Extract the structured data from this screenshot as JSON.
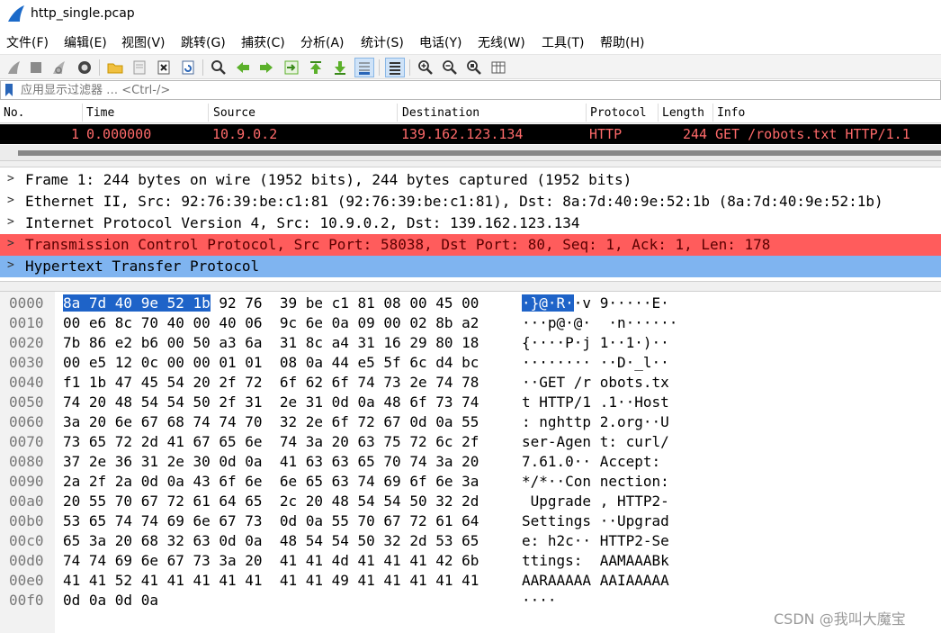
{
  "window": {
    "title": "http_single.pcap"
  },
  "menu": [
    {
      "label": "文件(F)"
    },
    {
      "label": "编辑(E)"
    },
    {
      "label": "视图(V)"
    },
    {
      "label": "跳转(G)"
    },
    {
      "label": "捕获(C)"
    },
    {
      "label": "分析(A)"
    },
    {
      "label": "统计(S)"
    },
    {
      "label": "电话(Y)"
    },
    {
      "label": "无线(W)"
    },
    {
      "label": "工具(T)"
    },
    {
      "label": "帮助(H)"
    }
  ],
  "toolbar_icons": [
    "start-capture",
    "stop-capture",
    "restart-capture",
    "capture-options",
    "open-file",
    "save-file",
    "close-file",
    "reload-file",
    "find-packet",
    "go-back",
    "go-forward",
    "go-to-packet",
    "go-first",
    "go-last",
    "autoscroll",
    "colorize",
    "zoom-in",
    "zoom-out",
    "zoom-normal",
    "resize-columns"
  ],
  "filter": {
    "placeholder": "应用显示过滤器 … <Ctrl-/>"
  },
  "packet_list": {
    "columns": [
      "No.",
      "Time",
      "Source",
      "Destination",
      "Protocol",
      "Length",
      "Info"
    ],
    "rows": [
      {
        "no": "1",
        "time": "0.000000",
        "source": "10.9.0.2",
        "destination": "139.162.123.134",
        "protocol": "HTTP",
        "length": "244",
        "info": "GET /robots.txt HTTP/1.1"
      }
    ]
  },
  "details": [
    "Frame 1: 244 bytes on wire (1952 bits), 244 bytes captured (1952 bits)",
    "Ethernet II, Src: 92:76:39:be:c1:81 (92:76:39:be:c1:81), Dst: 8a:7d:40:9e:52:1b (8a:7d:40:9e:52:1b)",
    "Internet Protocol Version 4, Src: 10.9.0.2, Dst: 139.162.123.134",
    "Transmission Control Protocol, Src Port: 58038, Dst Port: 80, Seq: 1, Ack: 1, Len: 178",
    "Hypertext Transfer Protocol"
  ],
  "colors": {
    "tcp_row_bg": "#ff5c5c",
    "tcp_row_text": "#5a0000",
    "http_row_bg": "#7fb4f0",
    "packet_row_bg": "#000000",
    "packet_row_text": "#ff6a6a",
    "selection_bg": "#1e63c8"
  },
  "hex": {
    "selected_hex": "8a 7d 40 9e 52 1b",
    "selected_ascii": "·}@·R·",
    "first_hex_rest": " 92 76  39 be c1 81 08 00 45 00",
    "first_ascii_rest": "·v 9·····E·",
    "lines": [
      {
        "offset": "0010",
        "hex": "00 e6 8c 70 40 00 40 06  9c 6e 0a 09 00 02 8b a2",
        "ascii": "···p@·@·  ·n······"
      },
      {
        "offset": "0020",
        "hex": "7b 86 e2 b6 00 50 a3 6a  31 8c a4 31 16 29 80 18",
        "ascii": "{····P·j 1··1·)··"
      },
      {
        "offset": "0030",
        "hex": "00 e5 12 0c 00 00 01 01  08 0a 44 e5 5f 6c d4 bc",
        "ascii": "········ ··D·_l··"
      },
      {
        "offset": "0040",
        "hex": "f1 1b 47 45 54 20 2f 72  6f 62 6f 74 73 2e 74 78",
        "ascii": "··GET /r obots.tx"
      },
      {
        "offset": "0050",
        "hex": "74 20 48 54 54 50 2f 31  2e 31 0d 0a 48 6f 73 74",
        "ascii": "t HTTP/1 .1··Host"
      },
      {
        "offset": "0060",
        "hex": "3a 20 6e 67 68 74 74 70  32 2e 6f 72 67 0d 0a 55",
        "ascii": ": nghttp 2.org··U"
      },
      {
        "offset": "0070",
        "hex": "73 65 72 2d 41 67 65 6e  74 3a 20 63 75 72 6c 2f",
        "ascii": "ser-Agen t: curl/"
      },
      {
        "offset": "0080",
        "hex": "37 2e 36 31 2e 30 0d 0a  41 63 63 65 70 74 3a 20",
        "ascii": "7.61.0·· Accept: "
      },
      {
        "offset": "0090",
        "hex": "2a 2f 2a 0d 0a 43 6f 6e  6e 65 63 74 69 6f 6e 3a",
        "ascii": "*/*··Con nection:"
      },
      {
        "offset": "00a0",
        "hex": "20 55 70 67 72 61 64 65  2c 20 48 54 54 50 32 2d",
        "ascii": " Upgrade , HTTP2-"
      },
      {
        "offset": "00b0",
        "hex": "53 65 74 74 69 6e 67 73  0d 0a 55 70 67 72 61 64",
        "ascii": "Settings ··Upgrad"
      },
      {
        "offset": "00c0",
        "hex": "65 3a 20 68 32 63 0d 0a  48 54 54 50 32 2d 53 65",
        "ascii": "e: h2c·· HTTP2-Se"
      },
      {
        "offset": "00d0",
        "hex": "74 74 69 6e 67 73 3a 20  41 41 4d 41 41 41 42 6b",
        "ascii": "ttings:  AAMAAABk"
      },
      {
        "offset": "00e0",
        "hex": "41 41 52 41 41 41 41 41  41 41 49 41 41 41 41 41",
        "ascii": "AARAAAAA AAIAAAAA"
      },
      {
        "offset": "00f0",
        "hex": "0d 0a 0d 0a",
        "ascii": "····"
      }
    ]
  },
  "watermark": "CSDN @我叫大魔宝"
}
